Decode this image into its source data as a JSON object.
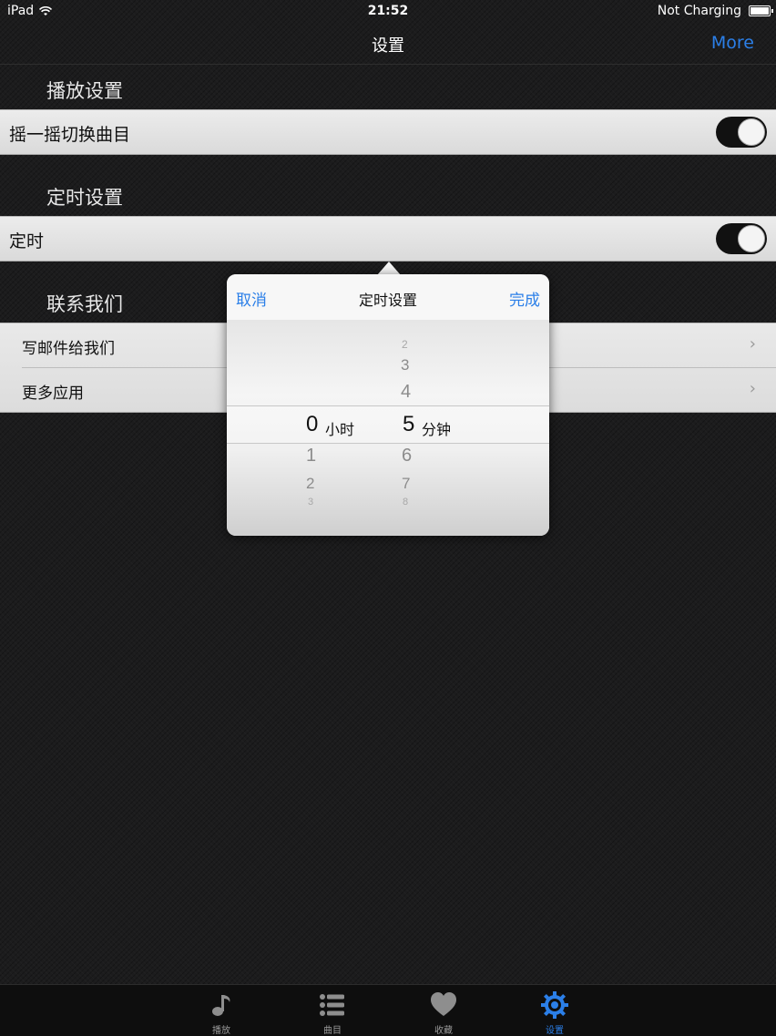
{
  "status_bar": {
    "device": "iPad",
    "time": "21:52",
    "battery_text": "Not Charging"
  },
  "nav": {
    "title": "设置",
    "more": "More"
  },
  "sections": {
    "playback": {
      "header": "播放设置",
      "row_label": "摇一摇切换曲目",
      "toggle_on": true
    },
    "timer": {
      "header": "定时设置",
      "row_label": "定时",
      "toggle_on": true
    },
    "contact": {
      "header": "联系我们",
      "items": [
        {
          "label": "写邮件给我们"
        },
        {
          "label": "更多应用"
        }
      ]
    }
  },
  "popover": {
    "cancel": "取消",
    "title": "定时设置",
    "done": "完成",
    "hours": {
      "above": [
        "",
        ""
      ],
      "selected": "0",
      "unit": "小时",
      "below": [
        "1",
        "2",
        "3"
      ]
    },
    "minutes": {
      "above": [
        "2",
        "3",
        "4"
      ],
      "selected": "5",
      "unit": "分钟",
      "below": [
        "6",
        "7",
        "8"
      ]
    }
  },
  "tabbar": {
    "items": [
      {
        "label": "播放",
        "icon": "music-note-icon",
        "active": false
      },
      {
        "label": "曲目",
        "icon": "list-icon",
        "active": false
      },
      {
        "label": "收藏",
        "icon": "heart-icon",
        "active": false
      },
      {
        "label": "设置",
        "icon": "gear-icon",
        "active": true
      }
    ]
  },
  "colors": {
    "accent": "#2b7fe8",
    "background": "#1c1c1d"
  }
}
